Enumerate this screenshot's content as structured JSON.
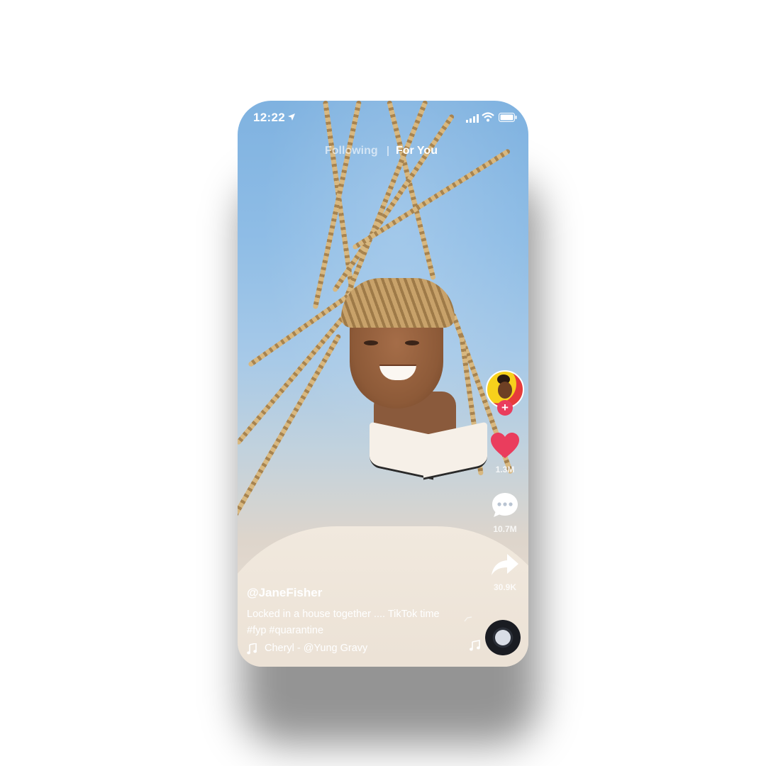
{
  "status_bar": {
    "time": "12:22"
  },
  "top_tabs": {
    "following": "Following",
    "for_you": "For You",
    "active": "For You"
  },
  "action_rail": {
    "follow_symbol": "+",
    "likes": "1.3M",
    "comments": "10.7M",
    "shares": "30.9K"
  },
  "caption": {
    "username": "@JaneFisher",
    "description": "Locked in a house together .... TikTok time #fyp #quarantine"
  },
  "sound": {
    "label": "Cheryl - @Yung Gravy"
  },
  "icons": {
    "status": [
      "location-arrow-icon",
      "signal-icon",
      "wifi-icon",
      "battery-icon"
    ],
    "rail": [
      "creator-avatar",
      "heart-icon",
      "comment-icon",
      "share-icon",
      "music-disc-icon"
    ],
    "sound": "music-note-icon"
  },
  "colors": {
    "like_red": "#ea3d5d",
    "text_white": "#ffffff",
    "sky_blue": "#7fb2e0"
  }
}
